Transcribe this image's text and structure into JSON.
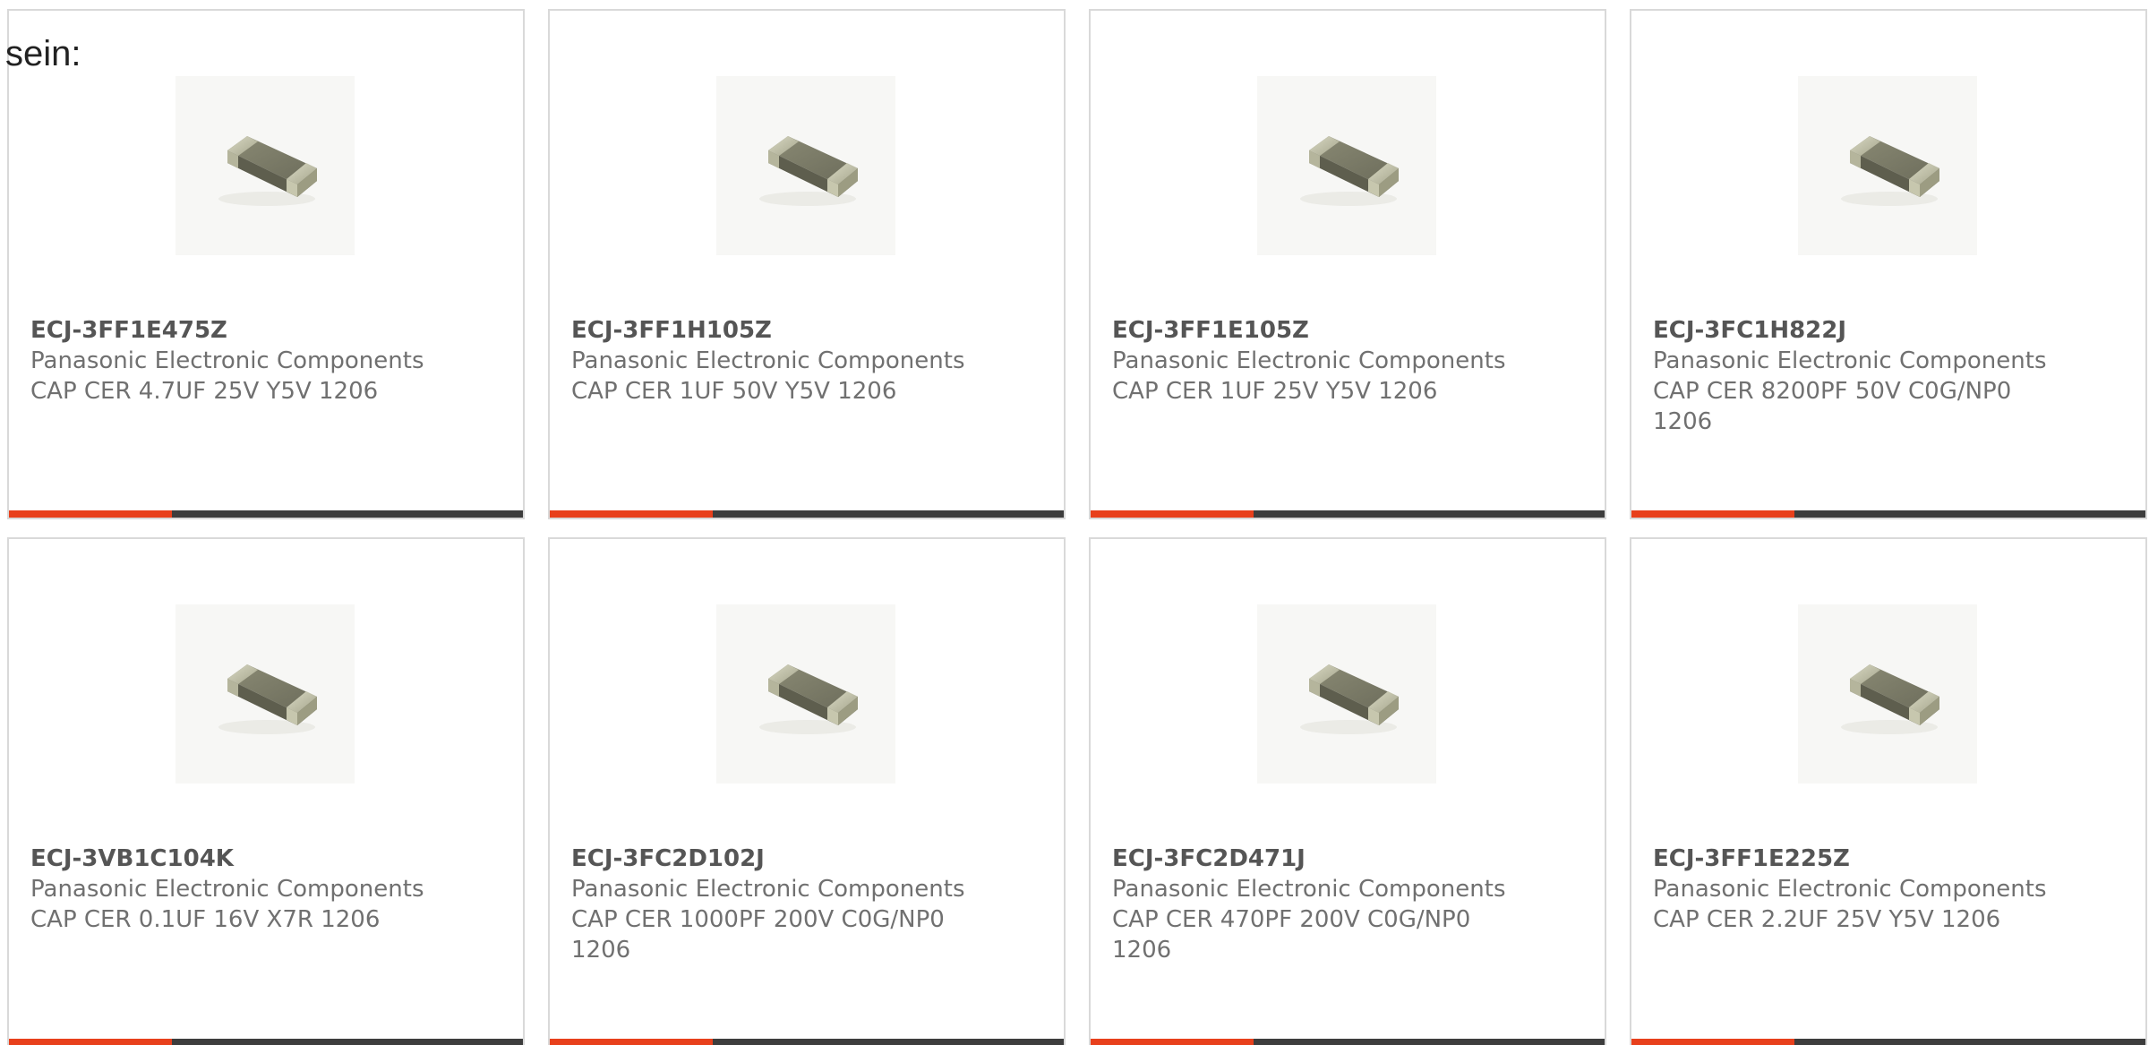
{
  "intro": {
    "text": "sein:"
  },
  "colors": {
    "accent": "#e8401c",
    "bar_dark": "#3d3d3d",
    "card_border": "#d9d9d9",
    "text_gray": "#707070"
  },
  "products": [
    {
      "part_number": "ECJ-3FF1E475Z",
      "manufacturer": "Panasonic Electronic Components",
      "description": "CAP CER 4.7UF 25V Y5V 1206",
      "image_icon": "ceramic-capacitor-chip-icon"
    },
    {
      "part_number": "ECJ-3FF1H105Z",
      "manufacturer": "Panasonic Electronic Components",
      "description": "CAP CER 1UF 50V Y5V 1206",
      "image_icon": "ceramic-capacitor-chip-icon"
    },
    {
      "part_number": "ECJ-3FF1E105Z",
      "manufacturer": "Panasonic Electronic Components",
      "description": "CAP CER 1UF 25V Y5V 1206",
      "image_icon": "ceramic-capacitor-chip-icon"
    },
    {
      "part_number": "ECJ-3FC1H822J",
      "manufacturer": "Panasonic Electronic Components",
      "description": "CAP CER 8200PF 50V C0G/NP0 1206",
      "image_icon": "ceramic-capacitor-chip-icon"
    },
    {
      "part_number": "ECJ-3VB1C104K",
      "manufacturer": "Panasonic Electronic Components",
      "description": "CAP CER 0.1UF 16V X7R 1206",
      "image_icon": "ceramic-capacitor-chip-icon"
    },
    {
      "part_number": "ECJ-3FC2D102J",
      "manufacturer": "Panasonic Electronic Components",
      "description": "CAP CER 1000PF 200V C0G/NP0 1206",
      "image_icon": "ceramic-capacitor-chip-icon"
    },
    {
      "part_number": "ECJ-3FC2D471J",
      "manufacturer": "Panasonic Electronic Components",
      "description": "CAP CER 470PF 200V C0G/NP0 1206",
      "image_icon": "ceramic-capacitor-chip-icon"
    },
    {
      "part_number": "ECJ-3FF1E225Z",
      "manufacturer": "Panasonic Electronic Components",
      "description": "CAP CER 2.2UF 25V Y5V 1206",
      "image_icon": "ceramic-capacitor-chip-icon"
    }
  ]
}
